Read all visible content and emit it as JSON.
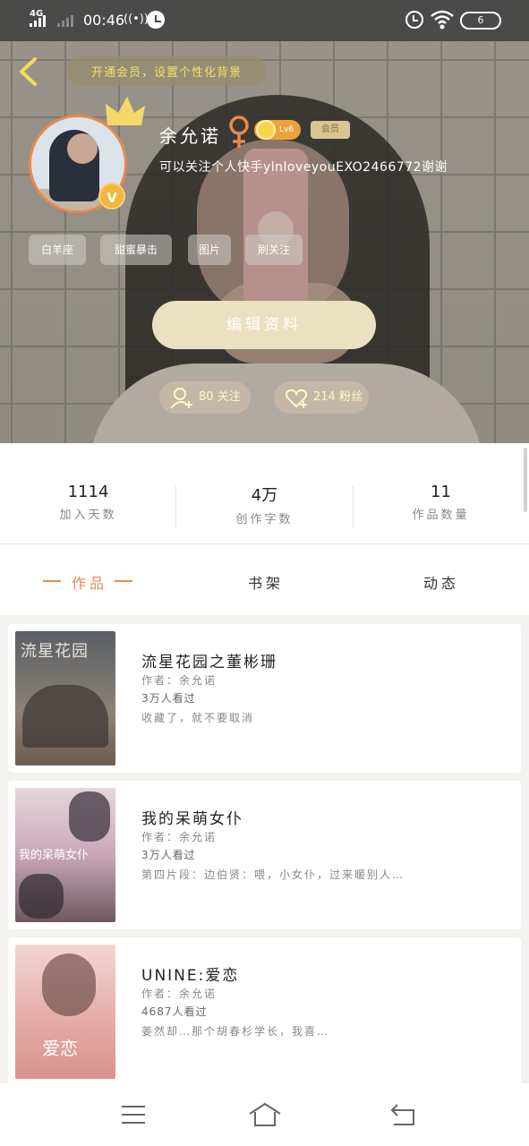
{
  "status_bar": {
    "network": "4G",
    "time": "00:46",
    "vibrate": "((•))",
    "battery": "6"
  },
  "profile": {
    "notice": "开通会员，设置个性化背景",
    "name": "余允诺",
    "level": "Lv6",
    "vip": "会员",
    "bio": "可以关注个人快手ylnloveyouEXO2466772谢谢",
    "tags": [
      "白羊座",
      "甜蜜暴击",
      "图片",
      "刷关注"
    ],
    "edit_label": "编辑资料",
    "following": "80 关注",
    "followers": "214 粉丝"
  },
  "stats": [
    {
      "value": "1114",
      "label": "加入天数"
    },
    {
      "value": "4万",
      "label": "创作字数"
    },
    {
      "value": "11",
      "label": "作品数量"
    }
  ],
  "tabs": [
    {
      "label": "作品"
    },
    {
      "label": "书架"
    },
    {
      "label": "动态"
    }
  ],
  "works": [
    {
      "title": "流星花园之董彬珊",
      "author": "作者：余允诺",
      "reads": "3万人看过",
      "desc": "收藏了，就不要取消",
      "cover_text": "流星花园"
    },
    {
      "title": "我的呆萌女仆",
      "author": "作者：余允诺",
      "reads": "3万人看过",
      "desc": "第四片段：边伯贤：喂，小女仆，过来暖别人…",
      "cover_text": "我的呆萌女仆"
    },
    {
      "title": "UNINE:爱恋",
      "author": "作者：余允诺",
      "reads": "4687人看过",
      "desc": "姜然却…那个胡春杉学长，我喜…",
      "cover_text": "爱恋"
    }
  ],
  "colors": {
    "accent": "#e8894e",
    "status_bar": "#4a4a49",
    "notice_text": "#f6df6a"
  }
}
